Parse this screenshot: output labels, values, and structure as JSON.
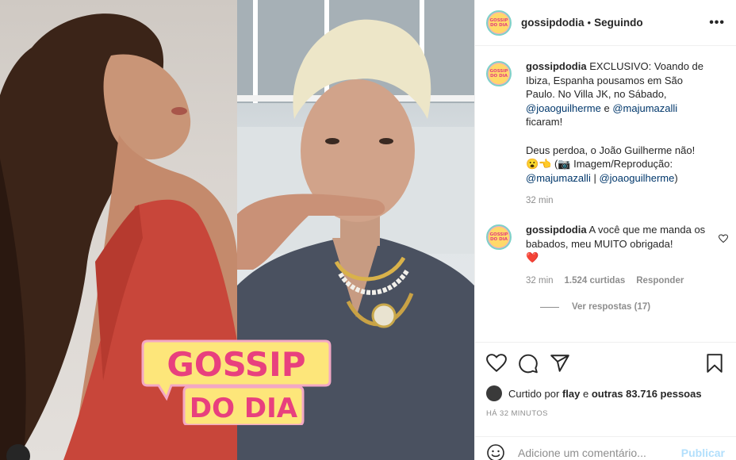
{
  "post": {
    "username": "gossipdodia",
    "separator": "•",
    "follow_label": "Seguindo",
    "more_label": "•••",
    "avatar_text": "GOSSIP DO DIA"
  },
  "media": {
    "logo_line1": "GOSSIP",
    "logo_line2": "DO DIA"
  },
  "caption": {
    "username": "gossipdodia",
    "text_1": "EXCLUSIVO: Voando de Ibiza, Espanha pousamos em São Paulo. No Villa JK, no Sábado,",
    "mention_1": "@joaoguilherme",
    "text_2": "e",
    "mention_2": "@majumazalli",
    "text_3": "ficaram!",
    "text_4": "Deus perdoa, o João Guilherme não!",
    "text_5": "😮👈 (📷 Imagem/Reprodução:",
    "mention_3": "@majumazalli",
    "text_6": "|",
    "mention_4": "@joaoguilherme",
    "text_7": ")",
    "time": "32 min"
  },
  "comment": {
    "username": "gossipdodia",
    "text": "A você que me manda os babados, meu MUITO obrigada!",
    "emoji": "❤️",
    "time": "32 min",
    "likes": "1.524 curtidas",
    "reply_label": "Responder",
    "view_replies": "Ver respostas (17)"
  },
  "actions": {
    "like_icon": "heart-icon",
    "comment_icon": "comment-icon",
    "share_icon": "send-icon",
    "save_icon": "bookmark-icon"
  },
  "likes": {
    "prefix": "Curtido por",
    "user": "flay",
    "middle": "e",
    "others": "outras 83.716 pessoas"
  },
  "timestamp": "HÁ 32 MINUTOS",
  "add_comment": {
    "placeholder": "Adicione um comentário...",
    "publish_label": "Publicar"
  },
  "colors": {
    "link": "#00376b",
    "muted": "#8e8e8e",
    "publish_disabled": "#b2dffc",
    "logo_pink": "#e8407e",
    "logo_yellow": "#fde67a"
  }
}
